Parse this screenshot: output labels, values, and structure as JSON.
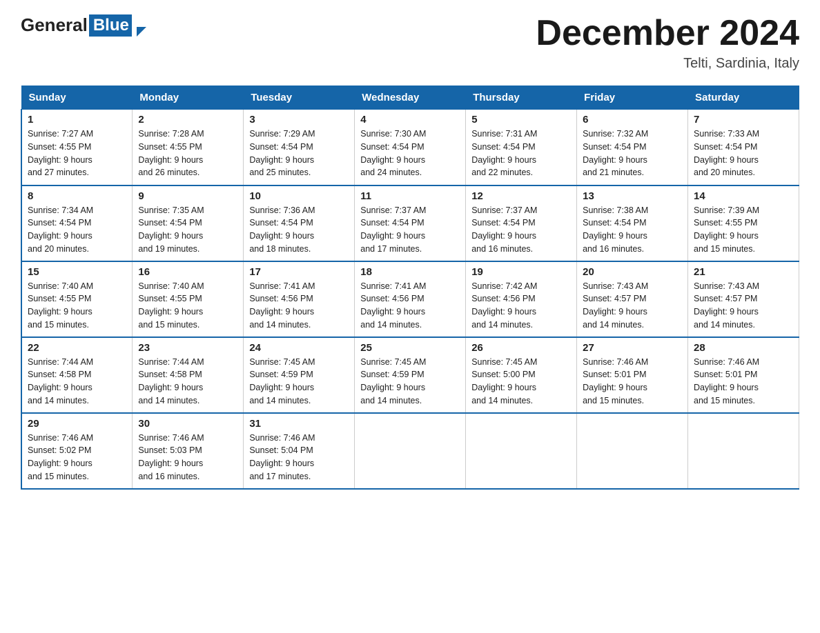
{
  "header": {
    "logo_general": "General",
    "logo_blue": "Blue",
    "month_title": "December 2024",
    "location": "Telti, Sardinia, Italy"
  },
  "days_of_week": [
    "Sunday",
    "Monday",
    "Tuesday",
    "Wednesday",
    "Thursday",
    "Friday",
    "Saturday"
  ],
  "weeks": [
    [
      {
        "day": "1",
        "sunrise": "7:27 AM",
        "sunset": "4:55 PM",
        "daylight": "9 hours and 27 minutes."
      },
      {
        "day": "2",
        "sunrise": "7:28 AM",
        "sunset": "4:55 PM",
        "daylight": "9 hours and 26 minutes."
      },
      {
        "day": "3",
        "sunrise": "7:29 AM",
        "sunset": "4:54 PM",
        "daylight": "9 hours and 25 minutes."
      },
      {
        "day": "4",
        "sunrise": "7:30 AM",
        "sunset": "4:54 PM",
        "daylight": "9 hours and 24 minutes."
      },
      {
        "day": "5",
        "sunrise": "7:31 AM",
        "sunset": "4:54 PM",
        "daylight": "9 hours and 22 minutes."
      },
      {
        "day": "6",
        "sunrise": "7:32 AM",
        "sunset": "4:54 PM",
        "daylight": "9 hours and 21 minutes."
      },
      {
        "day": "7",
        "sunrise": "7:33 AM",
        "sunset": "4:54 PM",
        "daylight": "9 hours and 20 minutes."
      }
    ],
    [
      {
        "day": "8",
        "sunrise": "7:34 AM",
        "sunset": "4:54 PM",
        "daylight": "9 hours and 20 minutes."
      },
      {
        "day": "9",
        "sunrise": "7:35 AM",
        "sunset": "4:54 PM",
        "daylight": "9 hours and 19 minutes."
      },
      {
        "day": "10",
        "sunrise": "7:36 AM",
        "sunset": "4:54 PM",
        "daylight": "9 hours and 18 minutes."
      },
      {
        "day": "11",
        "sunrise": "7:37 AM",
        "sunset": "4:54 PM",
        "daylight": "9 hours and 17 minutes."
      },
      {
        "day": "12",
        "sunrise": "7:37 AM",
        "sunset": "4:54 PM",
        "daylight": "9 hours and 16 minutes."
      },
      {
        "day": "13",
        "sunrise": "7:38 AM",
        "sunset": "4:54 PM",
        "daylight": "9 hours and 16 minutes."
      },
      {
        "day": "14",
        "sunrise": "7:39 AM",
        "sunset": "4:55 PM",
        "daylight": "9 hours and 15 minutes."
      }
    ],
    [
      {
        "day": "15",
        "sunrise": "7:40 AM",
        "sunset": "4:55 PM",
        "daylight": "9 hours and 15 minutes."
      },
      {
        "day": "16",
        "sunrise": "7:40 AM",
        "sunset": "4:55 PM",
        "daylight": "9 hours and 15 minutes."
      },
      {
        "day": "17",
        "sunrise": "7:41 AM",
        "sunset": "4:56 PM",
        "daylight": "9 hours and 14 minutes."
      },
      {
        "day": "18",
        "sunrise": "7:41 AM",
        "sunset": "4:56 PM",
        "daylight": "9 hours and 14 minutes."
      },
      {
        "day": "19",
        "sunrise": "7:42 AM",
        "sunset": "4:56 PM",
        "daylight": "9 hours and 14 minutes."
      },
      {
        "day": "20",
        "sunrise": "7:43 AM",
        "sunset": "4:57 PM",
        "daylight": "9 hours and 14 minutes."
      },
      {
        "day": "21",
        "sunrise": "7:43 AM",
        "sunset": "4:57 PM",
        "daylight": "9 hours and 14 minutes."
      }
    ],
    [
      {
        "day": "22",
        "sunrise": "7:44 AM",
        "sunset": "4:58 PM",
        "daylight": "9 hours and 14 minutes."
      },
      {
        "day": "23",
        "sunrise": "7:44 AM",
        "sunset": "4:58 PM",
        "daylight": "9 hours and 14 minutes."
      },
      {
        "day": "24",
        "sunrise": "7:45 AM",
        "sunset": "4:59 PM",
        "daylight": "9 hours and 14 minutes."
      },
      {
        "day": "25",
        "sunrise": "7:45 AM",
        "sunset": "4:59 PM",
        "daylight": "9 hours and 14 minutes."
      },
      {
        "day": "26",
        "sunrise": "7:45 AM",
        "sunset": "5:00 PM",
        "daylight": "9 hours and 14 minutes."
      },
      {
        "day": "27",
        "sunrise": "7:46 AM",
        "sunset": "5:01 PM",
        "daylight": "9 hours and 15 minutes."
      },
      {
        "day": "28",
        "sunrise": "7:46 AM",
        "sunset": "5:01 PM",
        "daylight": "9 hours and 15 minutes."
      }
    ],
    [
      {
        "day": "29",
        "sunrise": "7:46 AM",
        "sunset": "5:02 PM",
        "daylight": "9 hours and 15 minutes."
      },
      {
        "day": "30",
        "sunrise": "7:46 AM",
        "sunset": "5:03 PM",
        "daylight": "9 hours and 16 minutes."
      },
      {
        "day": "31",
        "sunrise": "7:46 AM",
        "sunset": "5:04 PM",
        "daylight": "9 hours and 17 minutes."
      },
      null,
      null,
      null,
      null
    ]
  ],
  "labels": {
    "sunrise": "Sunrise:",
    "sunset": "Sunset:",
    "daylight": "Daylight:"
  }
}
